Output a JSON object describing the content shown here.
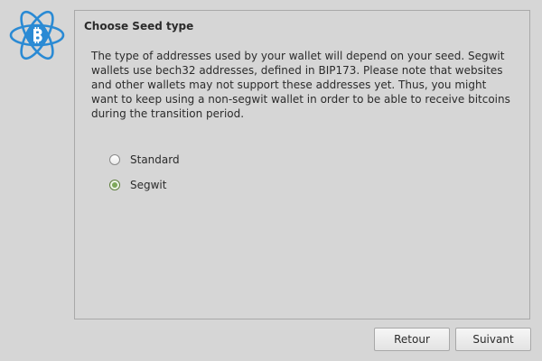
{
  "logo": {
    "icon": "electrum-bitcoin-atom-logo",
    "color": "#2a8ad4"
  },
  "page": {
    "title": "Choose Seed type",
    "description": "The type of addresses used by your wallet will depend on your seed. Segwit wallets use bech32 addresses, defined in BIP173. Please note that websites and other wallets may not support these addresses yet. Thus, you might want to keep using a non-segwit wallet in order to be able to receive bitcoins during the transition period."
  },
  "options": [
    {
      "label": "Standard",
      "checked": false
    },
    {
      "label": "Segwit",
      "checked": true
    }
  ],
  "buttons": {
    "back_label": "Retour",
    "next_label": "Suivant"
  }
}
